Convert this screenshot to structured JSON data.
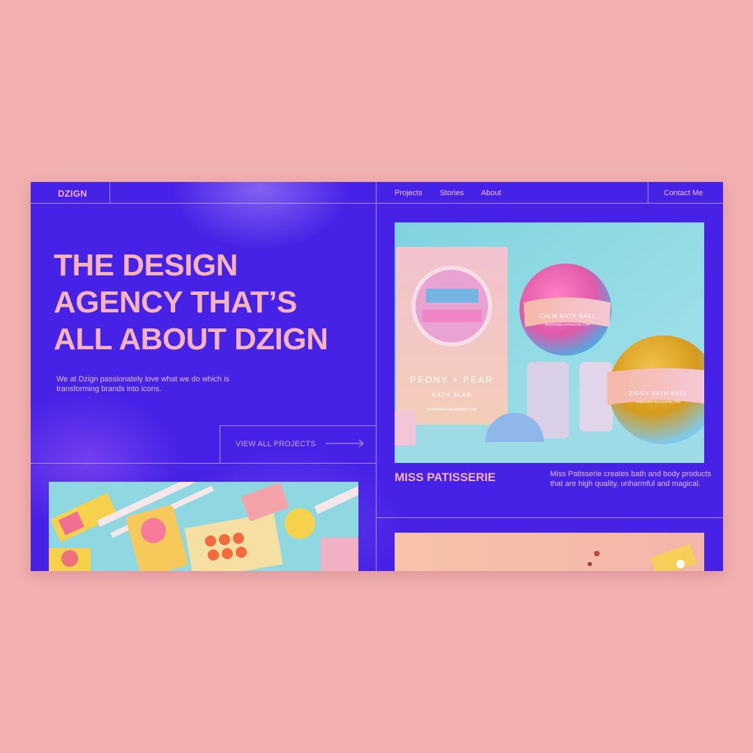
{
  "brand": {
    "logo": "DZIGN"
  },
  "nav": {
    "items": [
      {
        "label": "Projects"
      },
      {
        "label": "Stories"
      },
      {
        "label": "About"
      }
    ],
    "contact_label": "Contact Me"
  },
  "hero": {
    "title_lines": [
      "THE DESIGN",
      "AGENCY THAT’S",
      "ALL ABOUT DZIGN"
    ],
    "description": "We at Dzign passionately love what we do which is transforming brands into icons.",
    "cta_label": "VIEW ALL PROJECTS"
  },
  "featured": {
    "title": "MISS PATISSERIE",
    "description": "Miss Patisserie creates bath and body products that are high quality, unharmful and magical.",
    "image_labels": {
      "bath_slab_name": "PEONY + PEAR",
      "bath_slab_type": "BATH SLAB",
      "bath_slab_url": "WWW.MISS-PATISSERIE.COM",
      "ball1_name": "CALM BATH BALL",
      "ball1_url": "WWW.MISS-PATISSERIE.COM",
      "ball2_name": "ZIGGY BATH BALL",
      "ball2_url": "WWW.MISS-PATISSERIE.COM"
    }
  },
  "colors": {
    "page_background": "#f2afaf",
    "site_background": "#4621e6",
    "accent_pink": "#f6b3b9",
    "text_light": "#e4bfe6",
    "grid_line": "#ceb6ff"
  },
  "icons": {
    "cta_arrow": "arrow-right-icon"
  }
}
